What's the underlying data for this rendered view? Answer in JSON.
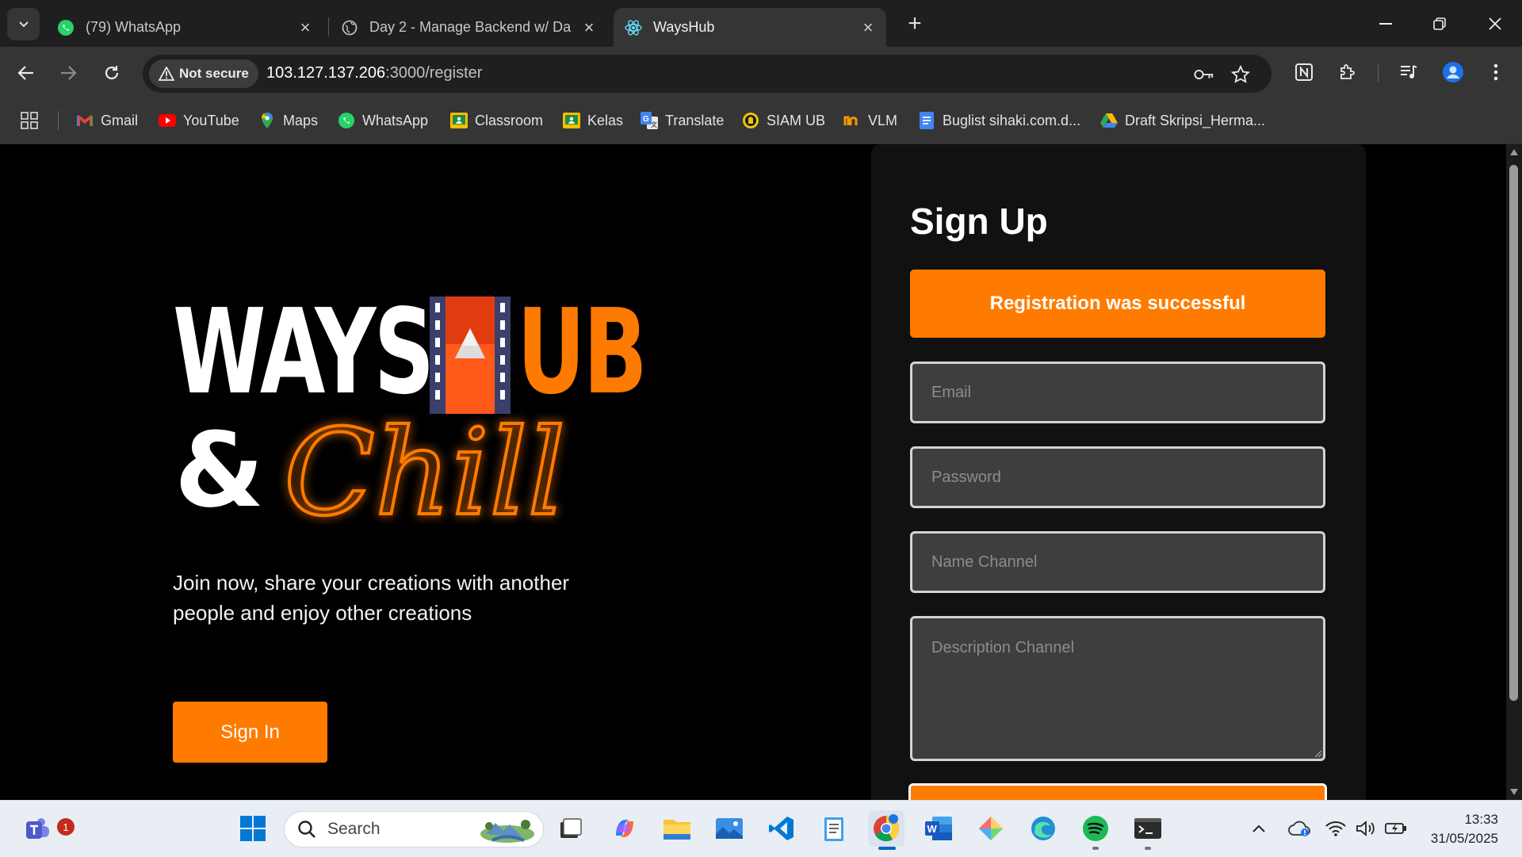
{
  "browser": {
    "tabs": [
      {
        "title": "(79) WhatsApp",
        "active": false
      },
      {
        "title": "Day 2 - Manage Backend w/ Da",
        "active": false
      },
      {
        "title": "WaysHub",
        "active": true
      }
    ],
    "security_label": "Not secure",
    "url_host": "103.127.137.206",
    "url_path": ":3000/register"
  },
  "bookmarks": [
    {
      "label": "Gmail",
      "icon": "gmail-icon"
    },
    {
      "label": "YouTube",
      "icon": "youtube-icon"
    },
    {
      "label": "Maps",
      "icon": "maps-icon"
    },
    {
      "label": "WhatsApp",
      "icon": "whatsapp-icon"
    },
    {
      "label": "Classroom",
      "icon": "classroom-icon"
    },
    {
      "label": "Kelas",
      "icon": "classroom-icon"
    },
    {
      "label": "Translate",
      "icon": "translate-icon"
    },
    {
      "label": "SIAM UB",
      "icon": "siam-icon"
    },
    {
      "label": "VLM",
      "icon": "vlm-icon"
    },
    {
      "label": "Buglist sihaki.com.d...",
      "icon": "docs-icon"
    },
    {
      "label": "Draft Skripsi_Herma...",
      "icon": "drive-icon"
    }
  ],
  "hero": {
    "logo_ways": "WAYS",
    "logo_ub": "UB",
    "logo_amp": "&",
    "logo_chill": "Chill",
    "tagline": "Join now, share your creations with another people and enjoy other creations",
    "signin_label": "Sign In"
  },
  "signup": {
    "title": "Sign Up",
    "alert": "Registration was successful",
    "email_placeholder": "Email",
    "password_placeholder": "Password",
    "name_placeholder": "Name Channel",
    "description_placeholder": "Description Channel"
  },
  "taskbar": {
    "search_label": "Search",
    "notification_count": "1",
    "time": "13:33",
    "date": "31/05/2025"
  },
  "colors": {
    "accent": "#ff7b00",
    "page_bg": "#000000",
    "card_bg": "#111111",
    "input_bg": "#3e3e3e"
  }
}
